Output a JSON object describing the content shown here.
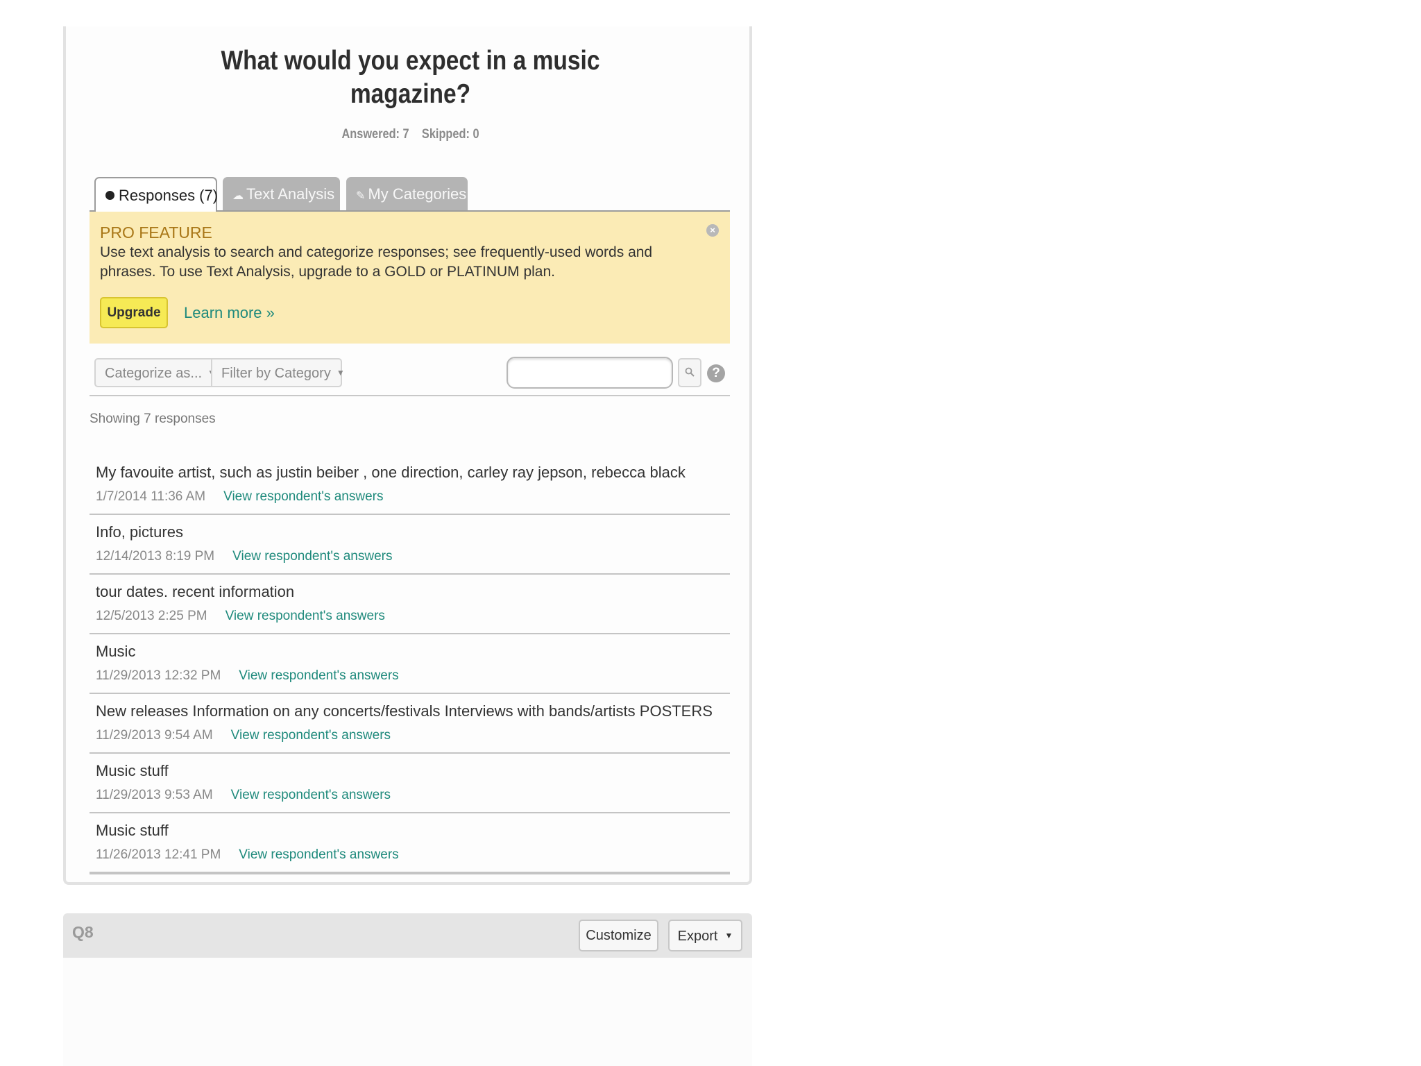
{
  "question": {
    "title_line1": "What would you expect in a music",
    "title_line2": "magazine?",
    "answered": "Answered: 7",
    "skipped": "Skipped: 0"
  },
  "tabs": [
    {
      "label": "Responses (7)",
      "icon": "bullet-icon",
      "active": true
    },
    {
      "label": "Text Analysis",
      "icon": "cloud-icon",
      "active": false
    },
    {
      "label": "My Categories",
      "icon": "tag-icon",
      "active": false
    }
  ],
  "pro_banner": {
    "title": "PRO FEATURE",
    "text": "Use text analysis to search and categorize responses; see frequently-used words and phrases. To use Text Analysis, upgrade to a GOLD or PLATINUM plan.",
    "upgrade_label": "Upgrade",
    "learn_more_label": "Learn more »",
    "close_glyph": "×"
  },
  "toolbar": {
    "categorize_label": "Categorize as...",
    "filter_label": "Filter by Category",
    "search_value": "",
    "help_glyph": "?"
  },
  "showing_text": "Showing 7 responses",
  "responses": [
    {
      "text": "My favouite artist, such as justin beiber , one direction, carley ray jepson, rebecca black",
      "date": "1/7/2014 11:36 AM",
      "link": "View respondent's answers"
    },
    {
      "text": "Info, pictures",
      "date": "12/14/2013 8:19 PM",
      "link": "View respondent's answers"
    },
    {
      "text": "tour dates. recent information",
      "date": "12/5/2013 2:25 PM",
      "link": "View respondent's answers"
    },
    {
      "text": "Music",
      "date": "11/29/2013 12:32 PM",
      "link": "View respondent's answers"
    },
    {
      "text": "New releases Information on any concerts/festivals Interviews with bands/artists POSTERS",
      "date": "11/29/2013 9:54 AM",
      "link": "View respondent's answers"
    },
    {
      "text": "Music stuff",
      "date": "11/29/2013 9:53 AM",
      "link": "View respondent's answers"
    },
    {
      "text": "Music stuff",
      "date": "11/26/2013 12:41 PM",
      "link": "View respondent's answers"
    }
  ],
  "next_question": {
    "label": "Q8",
    "customize_label": "Customize",
    "export_label": "Export"
  },
  "colors": {
    "banner_bg": "#fbebb5",
    "banner_title": "#a87616",
    "upgrade_bg": "#f6ea55",
    "link": "#1f8a7c",
    "inactive_tab": "#b4b4b4"
  }
}
